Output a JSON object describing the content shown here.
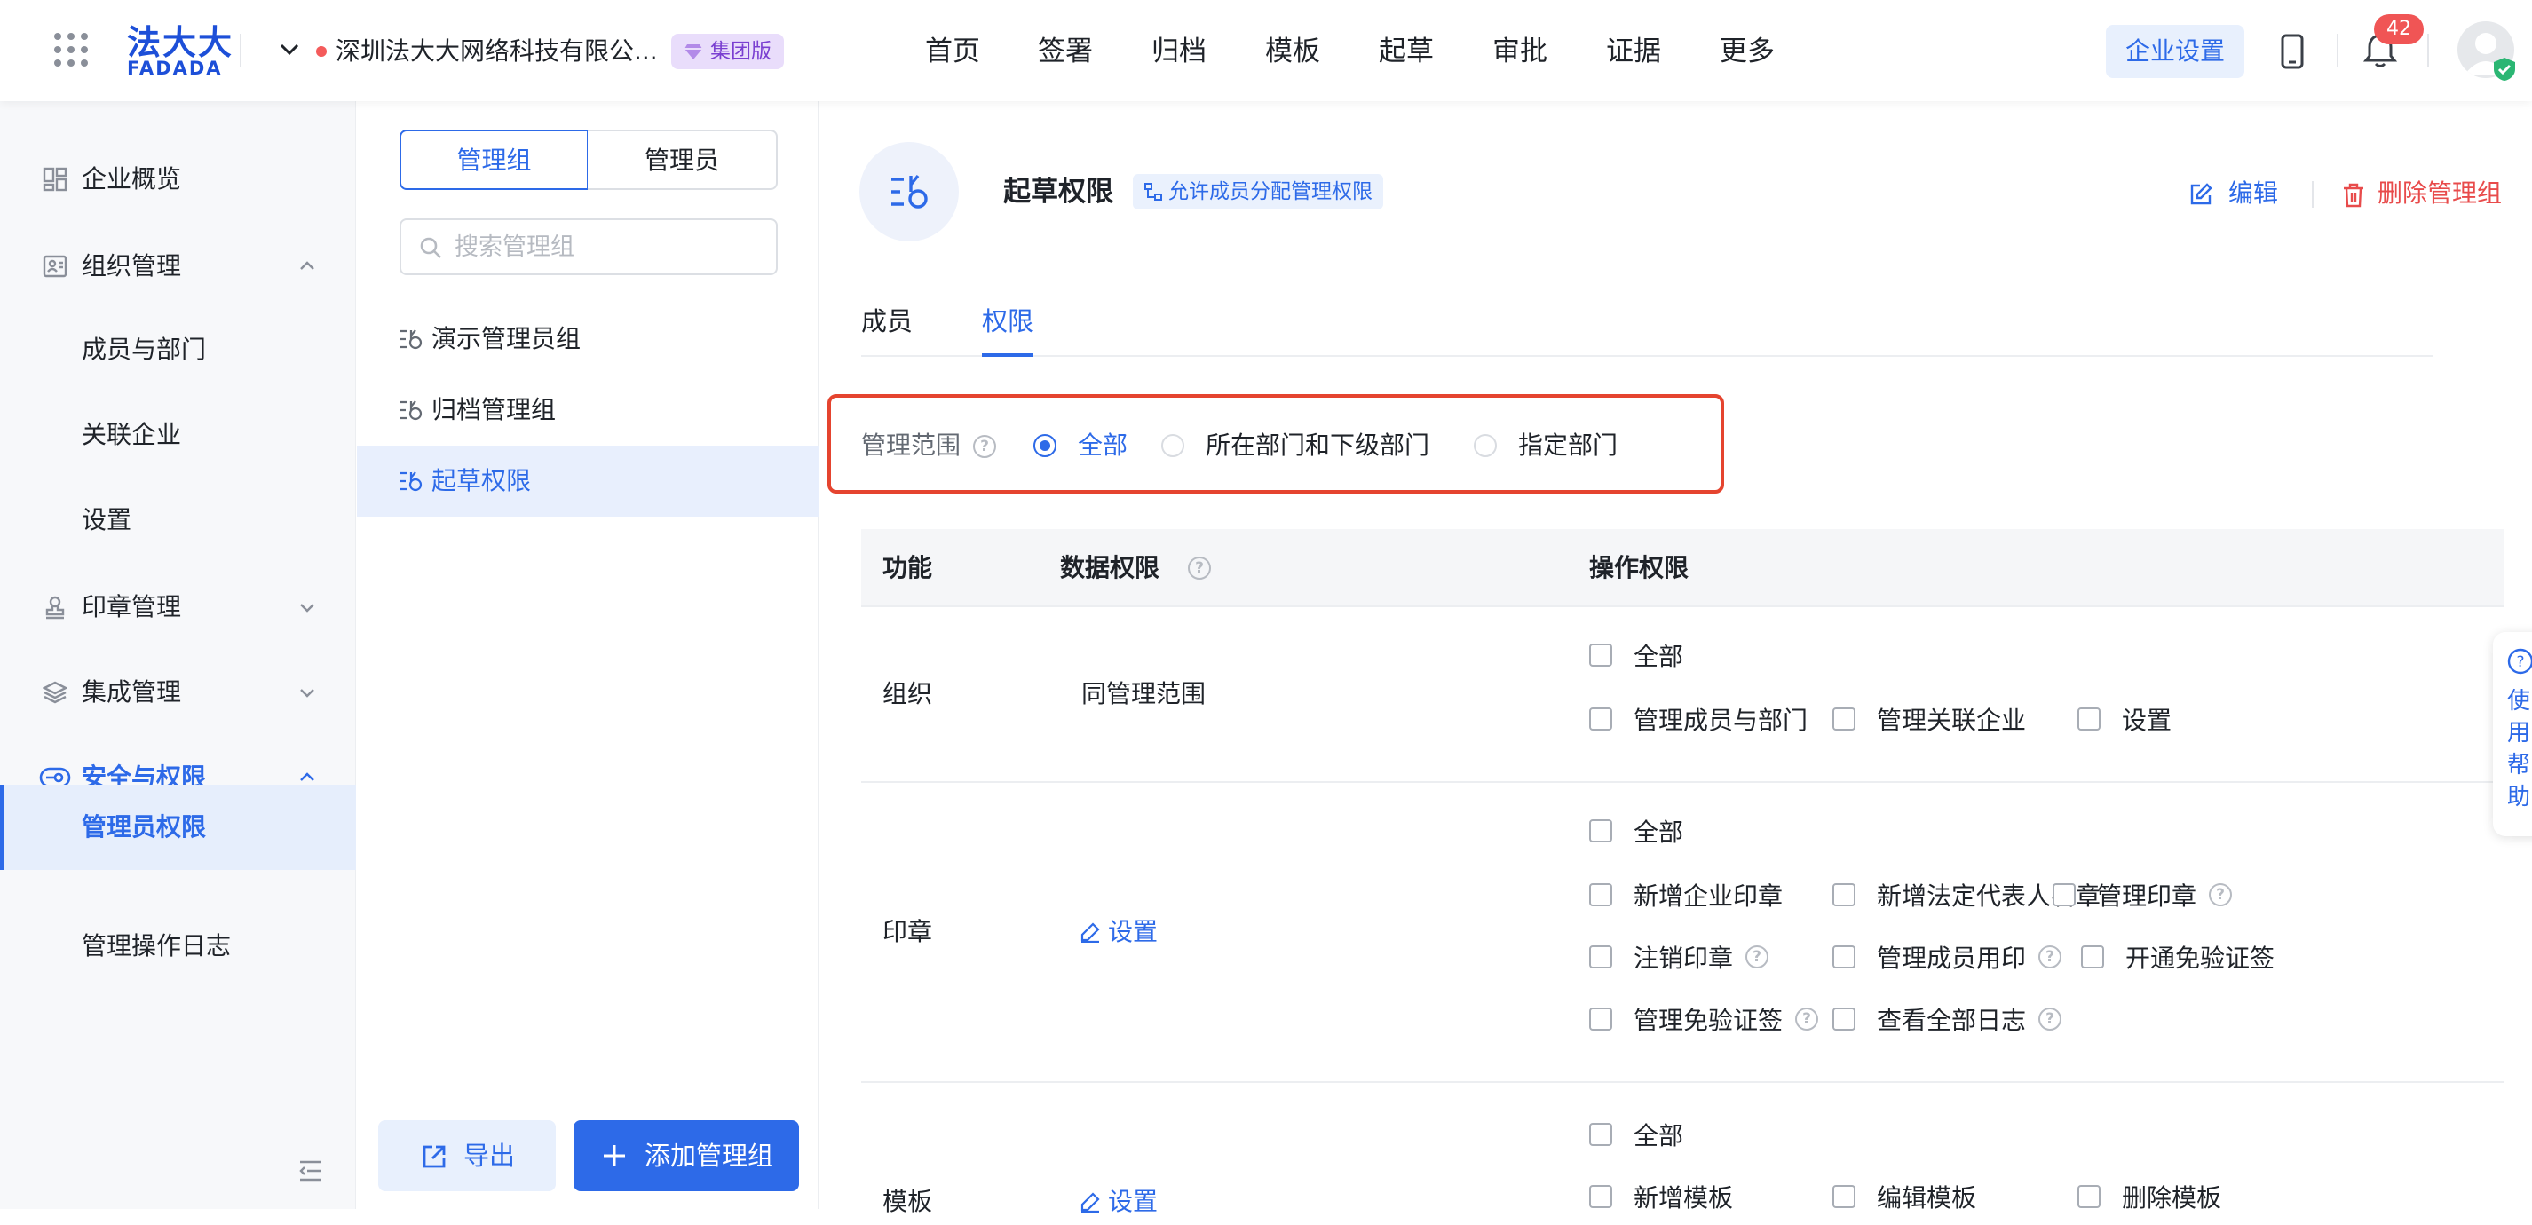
{
  "header": {
    "logo_cn": "法大大",
    "logo_en": "FADADA",
    "company_name": "深圳法大大网络科技有限公...",
    "edition_badge": "集团版",
    "nav": [
      "首页",
      "签署",
      "归档",
      "模板",
      "起草",
      "审批",
      "证据",
      "更多"
    ],
    "enterprise_settings": "企业设置",
    "notification_count": "42"
  },
  "sidebar": {
    "items": [
      {
        "label": "企业概览",
        "icon": "dashboard-icon"
      },
      {
        "label": "组织管理",
        "icon": "org-icon"
      },
      {
        "label": "成员与部门"
      },
      {
        "label": "关联企业"
      },
      {
        "label": "设置"
      },
      {
        "label": "印章管理",
        "icon": "seal-icon"
      },
      {
        "label": "集成管理",
        "icon": "layers-icon"
      },
      {
        "label": "安全与权限",
        "icon": "key-icon"
      },
      {
        "label": "管理员权限"
      },
      {
        "label": "管理操作日志"
      }
    ]
  },
  "group_panel": {
    "tab_groups": "管理组",
    "tab_admins": "管理员",
    "search_placeholder": "搜索管理组",
    "groups": [
      "演示管理员组",
      "归档管理组",
      "起草权限"
    ],
    "export_label": "导出",
    "add_label": "添加管理组"
  },
  "main": {
    "title": "起草权限",
    "allow_tag": "允许成员分配管理权限",
    "edit_label": "编辑",
    "delete_label": "删除管理组",
    "tabs": [
      "成员",
      "权限"
    ],
    "scope": {
      "label": "管理范围",
      "options": [
        "全部",
        "所在部门和下级部门",
        "指定部门"
      ],
      "selected": "全部"
    },
    "table": {
      "headers": [
        "功能",
        "数据权限",
        "操作权限"
      ],
      "rows": [
        {
          "func": "组织",
          "data": "同管理范围",
          "ops": [
            "全部",
            "管理成员与部门",
            "管理关联企业",
            "设置"
          ]
        },
        {
          "func": "印章",
          "data": "设置",
          "ops": [
            "全部",
            "新增企业印章",
            "新增法定代表人名章",
            "管理印章",
            "注销印章",
            "管理成员用印",
            "开通免验证签",
            "管理免验证签",
            "查看全部日志"
          ]
        },
        {
          "func": "模板",
          "data": "设置",
          "ops": [
            "全部",
            "新增模板",
            "编辑模板",
            "删除模板"
          ]
        }
      ]
    },
    "help_float": "使用帮助"
  },
  "colors": {
    "primary": "#2d6ae8",
    "danger": "#e84b4b",
    "highlight_border": "#e5442f",
    "badge_purple": "#7a3fd1"
  }
}
